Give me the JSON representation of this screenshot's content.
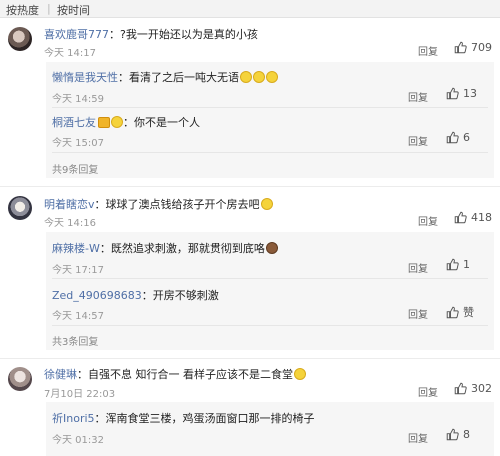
{
  "sort_bar": {
    "hot": "按热度",
    "separator": "|",
    "time": "按时间"
  },
  "reply_label": "回复",
  "comments": [
    {
      "username": "喜欢鹿哥777",
      "text": "：?我一开始还以为是真的小孩",
      "time": "今天 14:17",
      "likes": "709",
      "replies": [
        {
          "username": "懒惰是我天性",
          "text": "：看清了之后一吨大无语",
          "time": "今天 14:59",
          "likes": "13"
        },
        {
          "username": "桐酒七友",
          "text": "：你不是一个人",
          "time": "今天 15:07",
          "likes": "6"
        }
      ],
      "more_replies": "共9条回复"
    },
    {
      "username": "明着瞎恋v",
      "text": "：球球了澳点钱给孩子开个房去吧",
      "time": "今天 14:16",
      "likes": "418",
      "replies": [
        {
          "username": "麻辣楼-W",
          "text": "：既然追求刺激，那就贯彻到底咯",
          "time": "今天 17:17",
          "likes": "1"
        },
        {
          "username": "Zed_490698683",
          "text": "：开房不够刺激",
          "time": "今天 14:57",
          "likes": "赞"
        }
      ],
      "more_replies": "共3条回复"
    },
    {
      "username": "徐健琳",
      "text": "：自强不息 知行合一 看样子应该不是二食堂",
      "time": "7月10日 22:03",
      "likes": "302",
      "replies": [
        {
          "username": "祈Inori5",
          "text": "：浑南食堂三楼，鸡蛋汤面窗口那一排的椅子",
          "time": "今天 01:32",
          "likes": "8"
        }
      ]
    }
  ]
}
